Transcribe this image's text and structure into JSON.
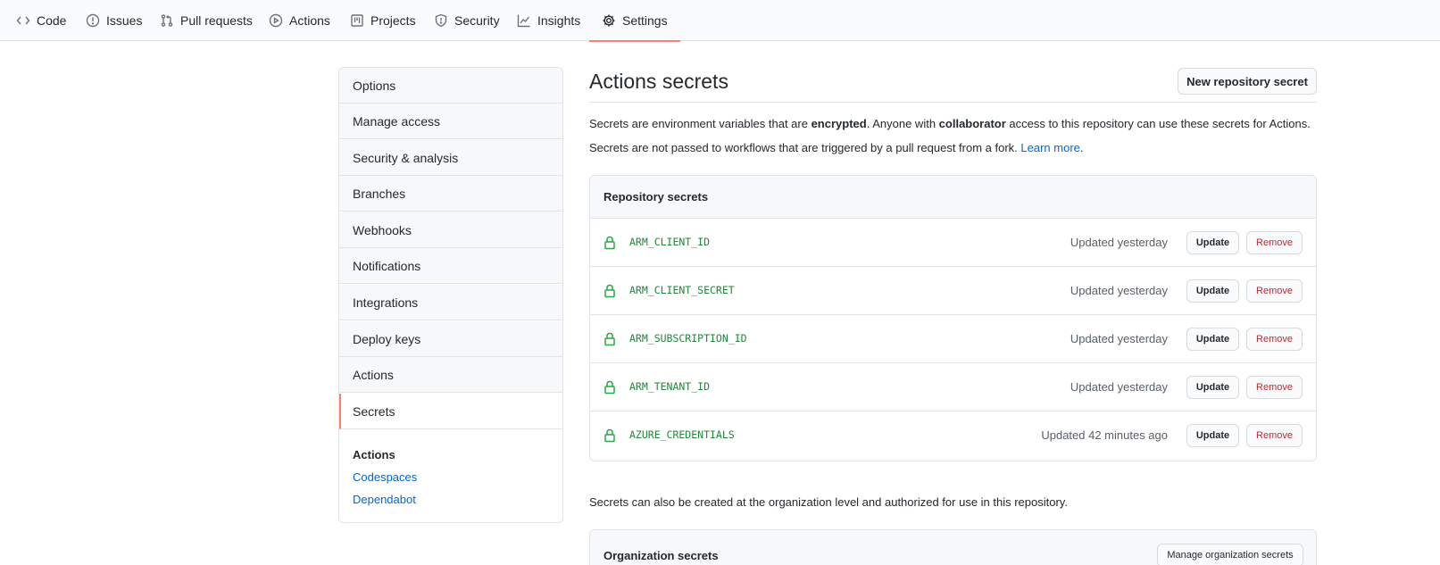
{
  "nav": {
    "tabs": [
      {
        "label": "Code",
        "icon": "code-icon"
      },
      {
        "label": "Issues",
        "icon": "issue-icon"
      },
      {
        "label": "Pull requests",
        "icon": "pull-request-icon"
      },
      {
        "label": "Actions",
        "icon": "play-icon"
      },
      {
        "label": "Projects",
        "icon": "project-icon"
      },
      {
        "label": "Security",
        "icon": "shield-icon"
      },
      {
        "label": "Insights",
        "icon": "graph-icon"
      },
      {
        "label": "Settings",
        "icon": "gear-icon",
        "selected": true
      }
    ]
  },
  "sidebar": {
    "items": [
      {
        "label": "Options"
      },
      {
        "label": "Manage access"
      },
      {
        "label": "Security & analysis"
      },
      {
        "label": "Branches"
      },
      {
        "label": "Webhooks"
      },
      {
        "label": "Notifications"
      },
      {
        "label": "Integrations"
      },
      {
        "label": "Deploy keys"
      },
      {
        "label": "Actions"
      },
      {
        "label": "Secrets",
        "selected": true
      }
    ],
    "sub_heading": "Actions",
    "sub_links": [
      "Codespaces",
      "Dependabot"
    ]
  },
  "main": {
    "title": "Actions secrets",
    "new_secret_button": "New repository secret",
    "desc1": {
      "part1": "Secrets are environment variables that are ",
      "bold1": "encrypted",
      "part2": ". Anyone with ",
      "bold2": "collaborator",
      "part3": " access to this repository can use these secrets for Actions."
    },
    "desc2": {
      "text": "Secrets are not passed to workflows that are triggered by a pull request from a fork. ",
      "link": "Learn more",
      "end": "."
    },
    "repo_secrets": {
      "heading": "Repository secrets",
      "update_label": "Update",
      "remove_label": "Remove",
      "rows": [
        {
          "name": "ARM_CLIENT_ID",
          "updated": "Updated yesterday"
        },
        {
          "name": "ARM_CLIENT_SECRET",
          "updated": "Updated yesterday"
        },
        {
          "name": "ARM_SUBSCRIPTION_ID",
          "updated": "Updated yesterday"
        },
        {
          "name": "ARM_TENANT_ID",
          "updated": "Updated yesterday"
        },
        {
          "name": "AZURE_CREDENTIALS",
          "updated": "Updated 42 minutes ago"
        }
      ]
    },
    "org_note": "Secrets can also be created at the organization level and authorized for use in this repository.",
    "org_secrets": {
      "heading": "Organization secrets",
      "manage_button": "Manage organization secrets"
    }
  },
  "colors": {
    "accent_underline": "#f9826c",
    "link": "#0366d6",
    "secret_name": "#22863a",
    "lock": "#28a745",
    "remove": "#cb2431"
  }
}
